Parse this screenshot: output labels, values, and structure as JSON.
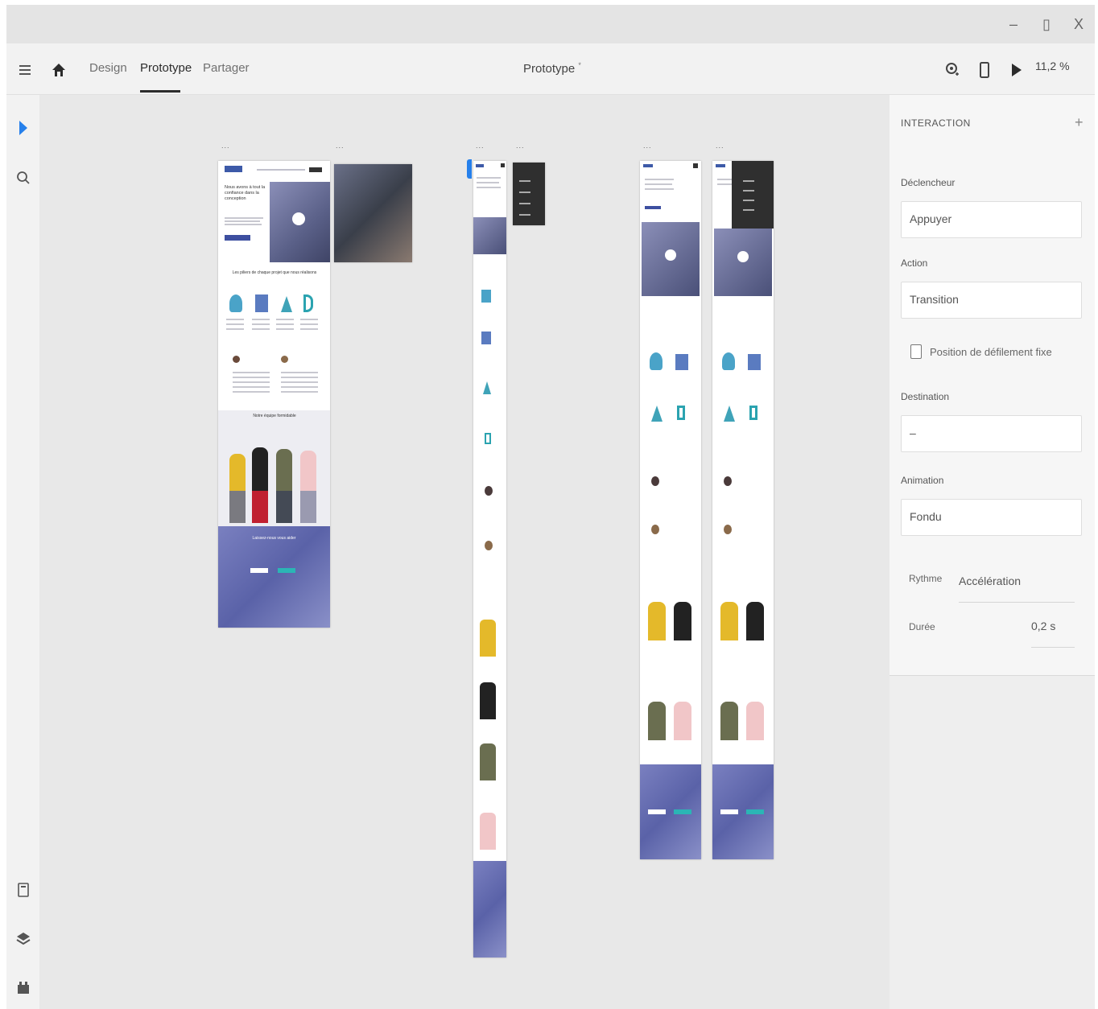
{
  "window": {
    "minimize": "–",
    "maximize": "▯",
    "close": "X"
  },
  "toolbar": {
    "tabs": [
      {
        "label": "Design"
      },
      {
        "label": "Prototype"
      },
      {
        "label": "Partager"
      }
    ],
    "document_title": "Prototype",
    "document_modified_mark": "*",
    "zoom": "11,2 %"
  },
  "icons": {
    "menu": "hamburger-menu-icon",
    "home": "home-icon",
    "record": "record-video-icon",
    "device": "mobile-device-icon",
    "play": "play-icon",
    "select": "select-arrow-icon",
    "zoom": "zoom-search-icon",
    "assets": "document-assets-icon",
    "layers": "layers-icon",
    "plugins": "plugins-icon"
  },
  "canvas": {
    "artboard_menu_glyph": "...",
    "desktop": {
      "hero_title": "Nous avons à tout la confiance dans la conception",
      "section_title": "Les piliers de chaque projet que nous réalisons",
      "team_title": "Notre équipe formidable",
      "cta_title": "Laissez-nous vous aider"
    }
  },
  "panel": {
    "header": "INTERACTION",
    "add": "+",
    "trigger_label": "Déclencheur",
    "trigger_value": "Appuyer",
    "action_label": "Action",
    "action_value": "Transition",
    "fixed_scroll_label": "Position de défilement fixe",
    "destination_label": "Destination",
    "destination_value": "–",
    "animation_label": "Animation",
    "animation_value": "Fondu",
    "easing_label": "Rythme",
    "easing_value": "Accélération",
    "duration_label": "Durée",
    "duration_value": "0,2 s"
  },
  "colors": {
    "accent_blue": "#2680eb",
    "hero_purple": "#6f6fb0",
    "teal": "#2bb5b5",
    "dark": "#3a3a3a"
  }
}
